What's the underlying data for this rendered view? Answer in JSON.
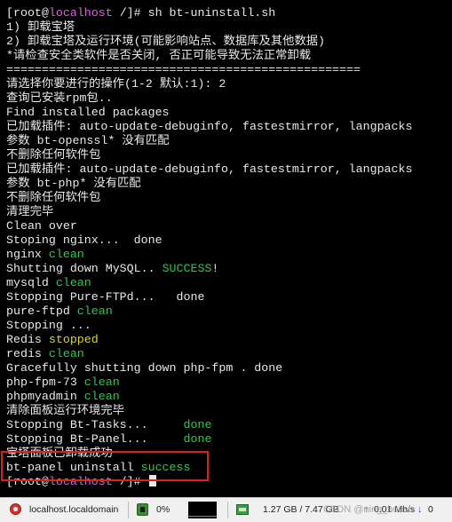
{
  "terminal": {
    "lines": [
      [
        {
          "text": "[root@",
          "style": "normal"
        },
        {
          "text": "localhost",
          "style": "highlight"
        },
        {
          "text": " /]# sh bt-uninstall.sh",
          "style": "normal"
        }
      ],
      [
        {
          "text": "1) 卸载宝塔",
          "style": "normal"
        }
      ],
      [
        {
          "text": "2) 卸载宝塔及运行环境(可能影响站点、数据库及其他数据)",
          "style": "normal"
        }
      ],
      [
        {
          "text": "*请检查安全类软件是否关闭, 否正可能导致无法正常卸载",
          "style": "normal"
        }
      ],
      [
        {
          "text": "==================================================",
          "style": "normal"
        }
      ],
      [
        {
          "text": "请选择你要进行的操作(1-2 默认:1): 2",
          "style": "normal"
        }
      ],
      [
        {
          "text": "查询已安装rpm包..",
          "style": "normal"
        }
      ],
      [
        {
          "text": "Find installed packages",
          "style": "normal"
        }
      ],
      [
        {
          "text": "已加载插件: auto-update-debuginfo, fastestmirror, langpacks",
          "style": "normal"
        }
      ],
      [
        {
          "text": "参数 bt-openssl* 没有匹配",
          "style": "normal"
        }
      ],
      [
        {
          "text": "不删除任何软件包",
          "style": "normal"
        }
      ],
      [
        {
          "text": "已加载插件: auto-update-debuginfo, fastestmirror, langpacks",
          "style": "normal"
        }
      ],
      [
        {
          "text": "参数 bt-php* 没有匹配",
          "style": "normal"
        }
      ],
      [
        {
          "text": "不删除任何软件包",
          "style": "normal"
        }
      ],
      [
        {
          "text": "清理完毕",
          "style": "normal"
        }
      ],
      [
        {
          "text": "Clean over",
          "style": "normal"
        }
      ],
      [
        {
          "text": "Stoping nginx...  done",
          "style": "normal"
        }
      ],
      [
        {
          "text": "nginx ",
          "style": "normal"
        },
        {
          "text": "clean",
          "style": "success"
        }
      ],
      [
        {
          "text": "Shutting down MySQL.. ",
          "style": "normal"
        },
        {
          "text": "SUCCESS",
          "style": "success"
        },
        {
          "text": "!",
          "style": "normal"
        }
      ],
      [
        {
          "text": "mysqld ",
          "style": "normal"
        },
        {
          "text": "clean",
          "style": "success"
        }
      ],
      [
        {
          "text": "Stopping Pure-FTPd...   done",
          "style": "normal"
        }
      ],
      [
        {
          "text": "pure-ftpd ",
          "style": "normal"
        },
        {
          "text": "clean",
          "style": "success"
        }
      ],
      [
        {
          "text": "Stopping ...",
          "style": "normal"
        }
      ],
      [
        {
          "text": "Redis ",
          "style": "normal"
        },
        {
          "text": "stopped",
          "style": "warn"
        }
      ],
      [
        {
          "text": "redis ",
          "style": "normal"
        },
        {
          "text": "clean",
          "style": "success"
        }
      ],
      [
        {
          "text": "Gracefully shutting down php-fpm . done",
          "style": "normal"
        }
      ],
      [
        {
          "text": "php-fpm-73 ",
          "style": "normal"
        },
        {
          "text": "clean",
          "style": "success"
        }
      ],
      [
        {
          "text": "phpmyadmin ",
          "style": "normal"
        },
        {
          "text": "clean",
          "style": "success"
        }
      ],
      [
        {
          "text": "清除面板运行环境完毕",
          "style": "normal"
        }
      ],
      [
        {
          "text": "Stopping Bt-Tasks...     ",
          "style": "normal"
        },
        {
          "text": "done",
          "style": "success"
        }
      ],
      [
        {
          "text": "Stopping Bt-Panel...     ",
          "style": "normal"
        },
        {
          "text": "done",
          "style": "success"
        }
      ],
      [
        {
          "text": "宝塔面板已卸载成功",
          "style": "normal"
        }
      ],
      [
        {
          "text": "bt-panel uninstall ",
          "style": "normal"
        },
        {
          "text": "success",
          "style": "success"
        }
      ],
      [
        {
          "text": "[root@",
          "style": "normal"
        },
        {
          "text": "localhost",
          "style": "highlight"
        },
        {
          "text": " /]# ",
          "style": "normal"
        }
      ]
    ],
    "colors": {
      "background": "#000000",
      "text": "#e8e8e8",
      "highlight": "#d966d9",
      "success": "#35c25a",
      "warn": "#d9d91c",
      "annotation_box": "#e0201c"
    }
  },
  "statusbar": {
    "host": "localhost.localdomain",
    "cpu": "0%",
    "memory": "1.27 GB / 7.47 GB",
    "upload": "0.01 Mb/s",
    "download": "0",
    "watermark": "CSDN @ning_bocsu",
    "icons": [
      "server-status-icon",
      "cpu-icon",
      "memory-icon",
      "upload-arrow-icon",
      "download-arrow-icon"
    ]
  }
}
